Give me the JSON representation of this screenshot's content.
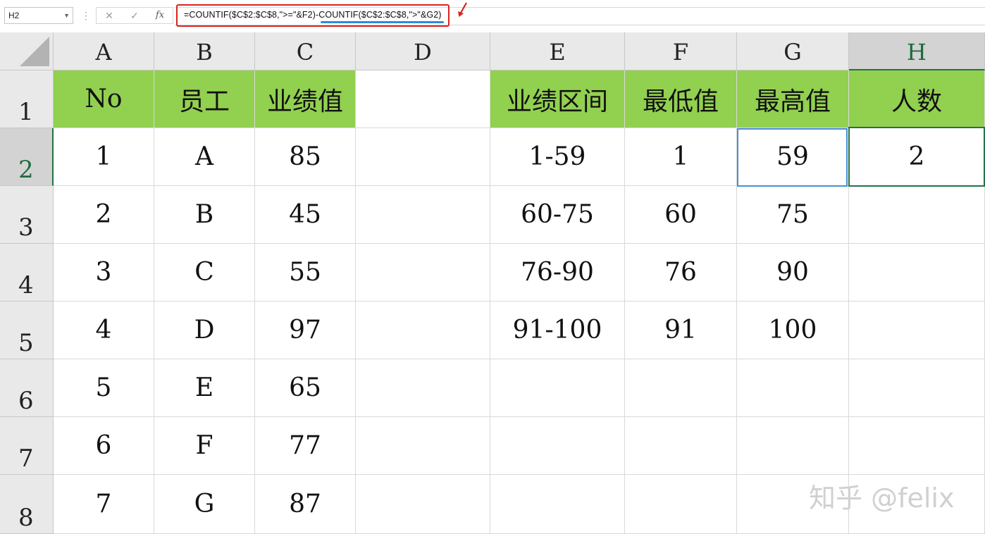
{
  "formula_bar": {
    "name_box": "H2",
    "cancel_icon": "✕",
    "enter_icon": "✓",
    "fx_label": "fx",
    "formula_part1": "=COUNTIF($C$2:$C$8,\">=\"&F2)-",
    "formula_part2": "COUNTIF($C$2:$C$8,\">\"&G2)",
    "highlight_color": "#d8231f",
    "underline_color": "#2f8ad9"
  },
  "columns": [
    "A",
    "B",
    "C",
    "D",
    "E",
    "F",
    "G",
    "H"
  ],
  "selected_column": "H",
  "rows": [
    "1",
    "2",
    "3",
    "4",
    "5",
    "6",
    "7",
    "8"
  ],
  "selected_row": "2",
  "header_fill": "#92d050",
  "table_left": {
    "headers": [
      "No",
      "员工",
      "业绩值"
    ],
    "rows": [
      [
        "1",
        "A",
        "85"
      ],
      [
        "2",
        "B",
        "45"
      ],
      [
        "3",
        "C",
        "55"
      ],
      [
        "4",
        "D",
        "97"
      ],
      [
        "5",
        "E",
        "65"
      ],
      [
        "6",
        "F",
        "77"
      ],
      [
        "7",
        "G",
        "87"
      ]
    ]
  },
  "table_right": {
    "headers": [
      "业绩区间",
      "最低值",
      "最高值",
      "人数"
    ],
    "rows": [
      [
        "1-59",
        "1",
        "59",
        "2"
      ],
      [
        "60-75",
        "60",
        "75",
        ""
      ],
      [
        "76-90",
        "76",
        "90",
        ""
      ],
      [
        "91-100",
        "91",
        "100",
        ""
      ]
    ]
  },
  "watermark": "知乎 @felix"
}
